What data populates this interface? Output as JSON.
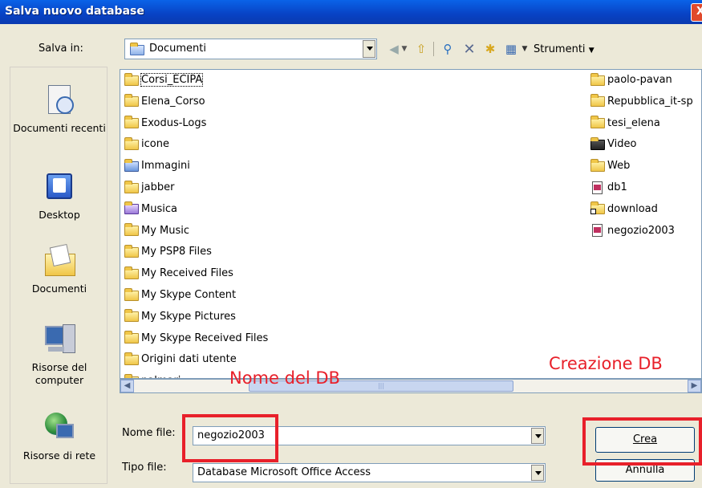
{
  "window": {
    "title": "Salva nuovo database",
    "close_label": "X"
  },
  "toolbar": {
    "save_in_label": "Salva in:",
    "location_value": "Documenti",
    "tools_label": "Strumenti"
  },
  "places": [
    {
      "label": "Documenti recenti",
      "icon": "recent-documents-icon"
    },
    {
      "label": "Desktop",
      "icon": "desktop-icon"
    },
    {
      "label": "Documenti",
      "icon": "documents-icon"
    },
    {
      "label": "Risorse del computer",
      "icon": "computer-icon"
    },
    {
      "label": "Risorse di rete",
      "icon": "network-icon"
    }
  ],
  "files": {
    "column1": [
      {
        "name": "Corsi_ECIPA",
        "icon": "folder"
      },
      {
        "name": "Elena_Corso",
        "icon": "folder"
      },
      {
        "name": "Exodus-Logs",
        "icon": "folder"
      },
      {
        "name": "icone",
        "icon": "folder"
      },
      {
        "name": "Immagini",
        "icon": "pictures-folder"
      },
      {
        "name": "jabber",
        "icon": "folder"
      },
      {
        "name": "Musica",
        "icon": "music-folder"
      },
      {
        "name": "My Music",
        "icon": "folder"
      },
      {
        "name": "My PSP8 Files",
        "icon": "folder"
      },
      {
        "name": "My Received Files",
        "icon": "folder"
      },
      {
        "name": "My Skype Content",
        "icon": "folder"
      },
      {
        "name": "My Skype Pictures",
        "icon": "folder"
      },
      {
        "name": "My Skype Received Files",
        "icon": "folder"
      },
      {
        "name": "Origini dati utente",
        "icon": "datasource-folder"
      },
      {
        "name": "palmari",
        "icon": "folder"
      }
    ],
    "column2": [
      {
        "name": "paolo-pavan",
        "icon": "folder"
      },
      {
        "name": "Repubblica_it-sp",
        "icon": "folder"
      },
      {
        "name": "tesi_elena",
        "icon": "folder"
      },
      {
        "name": "Video",
        "icon": "video-folder"
      },
      {
        "name": "Web",
        "icon": "folder"
      },
      {
        "name": "db1",
        "icon": "access-db"
      },
      {
        "name": "download",
        "icon": "shortcut-folder"
      },
      {
        "name": "negozio2003",
        "icon": "access-db"
      }
    ]
  },
  "form": {
    "filename_label": "Nome file:",
    "filename_value": "negozio2003",
    "filetype_label": "Tipo file:",
    "filetype_value": "Database Microsoft Office Access",
    "create_label": "Crea",
    "cancel_label": "Annulla"
  },
  "annotations": {
    "db_name": "Nome del DB",
    "db_create": "Creazione DB",
    "color": "#e8202a"
  }
}
